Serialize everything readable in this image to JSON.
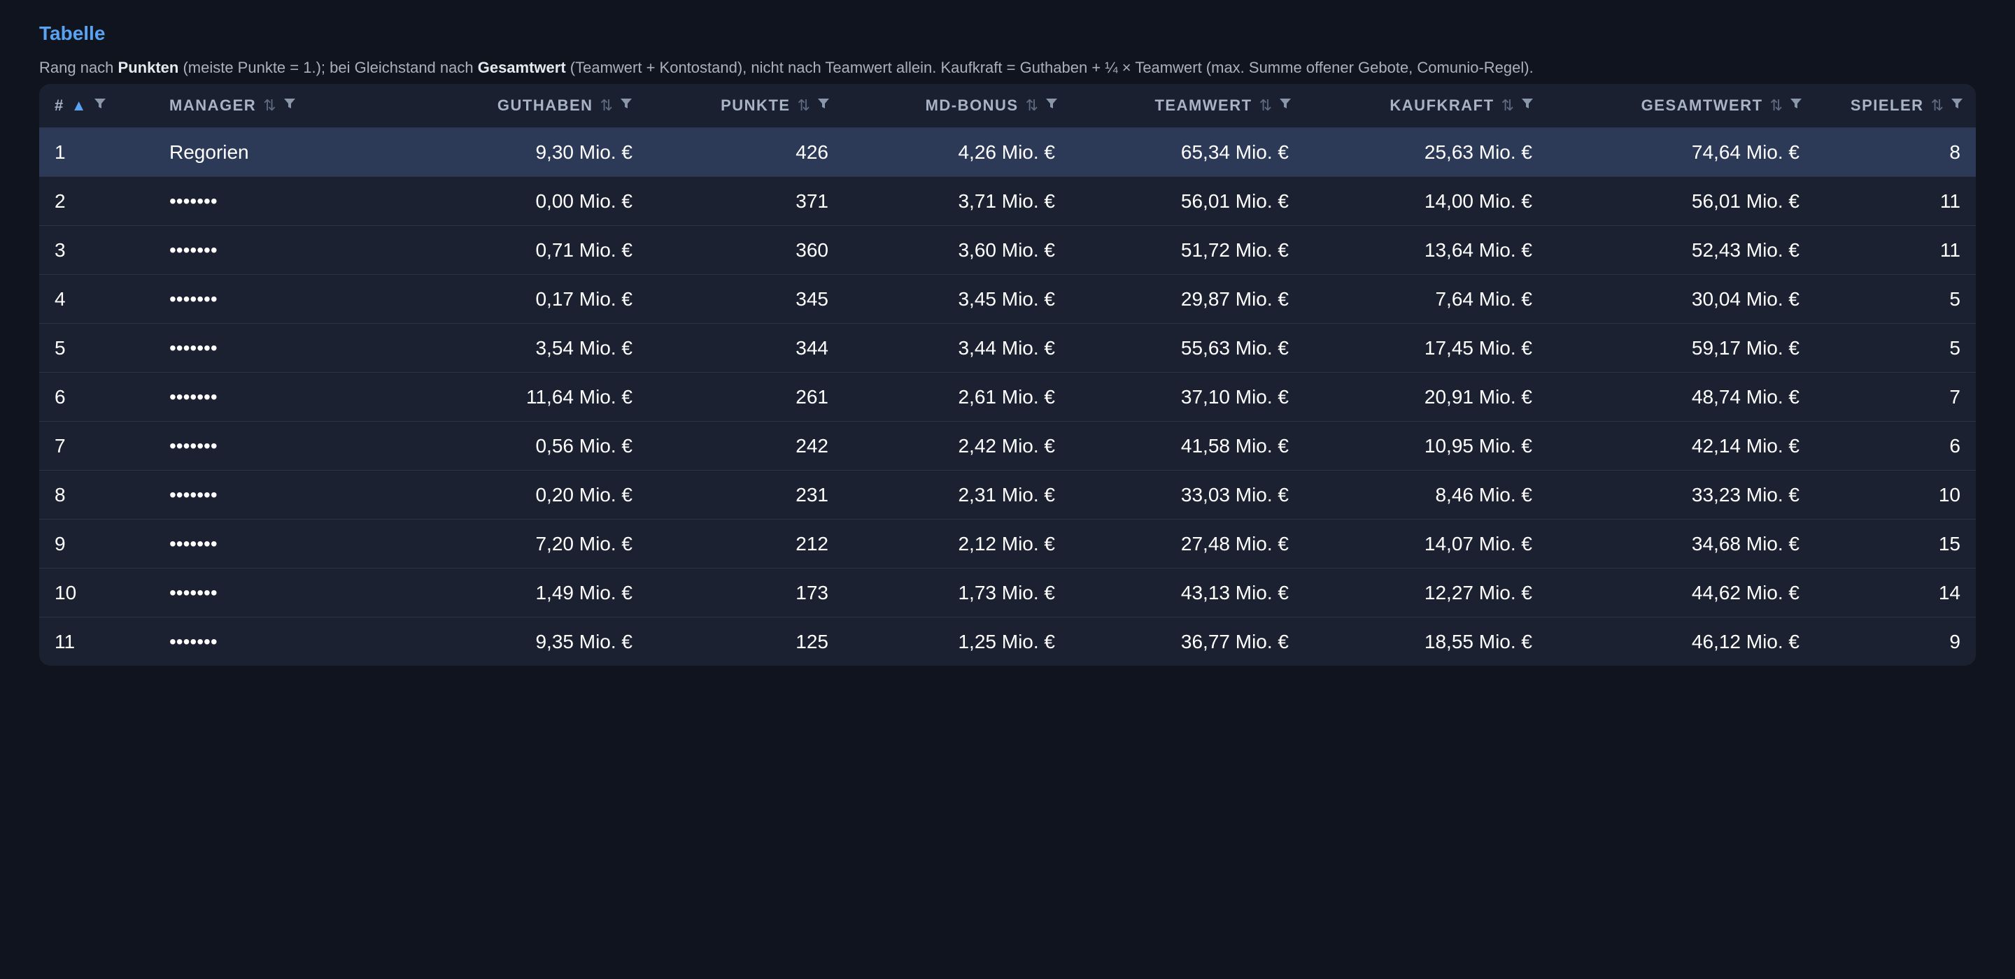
{
  "page": {
    "title": "Tabelle",
    "description": {
      "p1": "Rang nach ",
      "b1": "Punkten",
      "p2": " (meiste Punkte = 1.); bei Gleichstand nach ",
      "b2": "Gesamtwert",
      "p3": " (Teamwert + Kontostand), nicht nach Teamwert allein. Kaufkraft = Guthaben + ¼ × Teamwert (max. Summe offener Gebote, Comunio-Regel)."
    }
  },
  "colors": {
    "background": "#10141e",
    "table_bg": "#1b2130",
    "highlight_row": "#2c3a58",
    "accent": "#5aa2f2",
    "header_text": "#a8b3c6"
  },
  "table": {
    "columns": [
      {
        "key": "rank",
        "label": "#",
        "sort": "ascending",
        "sort_icon": "sort-ascending-icon"
      },
      {
        "key": "manager",
        "label": "MANAGER",
        "sort": "none",
        "sort_icon": "sort-both-icon"
      },
      {
        "key": "guthaben",
        "label": "GUTHABEN",
        "sort": "none",
        "sort_icon": "sort-both-icon"
      },
      {
        "key": "punkte",
        "label": "PUNKTE",
        "sort": "none",
        "sort_icon": "sort-both-icon"
      },
      {
        "key": "md_bonus",
        "label": "MD-BONUS",
        "sort": "none",
        "sort_icon": "sort-both-icon"
      },
      {
        "key": "teamwert",
        "label": "TEAMWERT",
        "sort": "none",
        "sort_icon": "sort-both-icon"
      },
      {
        "key": "kaufkraft",
        "label": "KAUFKRAFT",
        "sort": "none",
        "sort_icon": "sort-both-icon"
      },
      {
        "key": "gesamtwert",
        "label": "GESAMTWERT",
        "sort": "none",
        "sort_icon": "sort-both-icon"
      },
      {
        "key": "spieler",
        "label": "SPIELER",
        "sort": "none",
        "sort_icon": "sort-both-icon"
      }
    ],
    "sort_glyphs": {
      "ascending": "▲",
      "both": "⇅"
    },
    "rows": [
      {
        "rank": "1",
        "manager": "Regorien",
        "guthaben": "9,30 Mio. €",
        "punkte": "426",
        "md_bonus": "4,26 Mio. €",
        "teamwert": "65,34 Mio. €",
        "kaufkraft": "25,63 Mio. €",
        "gesamtwert": "74,64 Mio. €",
        "spieler": "8",
        "highlighted": true
      },
      {
        "rank": "2",
        "manager": "•••••••",
        "guthaben": "0,00 Mio. €",
        "punkte": "371",
        "md_bonus": "3,71 Mio. €",
        "teamwert": "56,01 Mio. €",
        "kaufkraft": "14,00 Mio. €",
        "gesamtwert": "56,01 Mio. €",
        "spieler": "11",
        "highlighted": false
      },
      {
        "rank": "3",
        "manager": "•••••••",
        "guthaben": "0,71 Mio. €",
        "punkte": "360",
        "md_bonus": "3,60 Mio. €",
        "teamwert": "51,72 Mio. €",
        "kaufkraft": "13,64 Mio. €",
        "gesamtwert": "52,43 Mio. €",
        "spieler": "11",
        "highlighted": false
      },
      {
        "rank": "4",
        "manager": "•••••••",
        "guthaben": "0,17 Mio. €",
        "punkte": "345",
        "md_bonus": "3,45 Mio. €",
        "teamwert": "29,87 Mio. €",
        "kaufkraft": "7,64 Mio. €",
        "gesamtwert": "30,04 Mio. €",
        "spieler": "5",
        "highlighted": false
      },
      {
        "rank": "5",
        "manager": "•••••••",
        "guthaben": "3,54 Mio. €",
        "punkte": "344",
        "md_bonus": "3,44 Mio. €",
        "teamwert": "55,63 Mio. €",
        "kaufkraft": "17,45 Mio. €",
        "gesamtwert": "59,17 Mio. €",
        "spieler": "5",
        "highlighted": false
      },
      {
        "rank": "6",
        "manager": "•••••••",
        "guthaben": "11,64 Mio. €",
        "punkte": "261",
        "md_bonus": "2,61 Mio. €",
        "teamwert": "37,10 Mio. €",
        "kaufkraft": "20,91 Mio. €",
        "gesamtwert": "48,74 Mio. €",
        "spieler": "7",
        "highlighted": false
      },
      {
        "rank": "7",
        "manager": "•••••••",
        "guthaben": "0,56 Mio. €",
        "punkte": "242",
        "md_bonus": "2,42 Mio. €",
        "teamwert": "41,58 Mio. €",
        "kaufkraft": "10,95 Mio. €",
        "gesamtwert": "42,14 Mio. €",
        "spieler": "6",
        "highlighted": false
      },
      {
        "rank": "8",
        "manager": "•••••••",
        "guthaben": "0,20 Mio. €",
        "punkte": "231",
        "md_bonus": "2,31 Mio. €",
        "teamwert": "33,03 Mio. €",
        "kaufkraft": "8,46 Mio. €",
        "gesamtwert": "33,23 Mio. €",
        "spieler": "10",
        "highlighted": false
      },
      {
        "rank": "9",
        "manager": "•••••••",
        "guthaben": "7,20 Mio. €",
        "punkte": "212",
        "md_bonus": "2,12 Mio. €",
        "teamwert": "27,48 Mio. €",
        "kaufkraft": "14,07 Mio. €",
        "gesamtwert": "34,68 Mio. €",
        "spieler": "15",
        "highlighted": false
      },
      {
        "rank": "10",
        "manager": "•••••••",
        "guthaben": "1,49 Mio. €",
        "punkte": "173",
        "md_bonus": "1,73 Mio. €",
        "teamwert": "43,13 Mio. €",
        "kaufkraft": "12,27 Mio. €",
        "gesamtwert": "44,62 Mio. €",
        "spieler": "14",
        "highlighted": false
      },
      {
        "rank": "11",
        "manager": "•••••••",
        "guthaben": "9,35 Mio. €",
        "punkte": "125",
        "md_bonus": "1,25 Mio. €",
        "teamwert": "36,77 Mio. €",
        "kaufkraft": "18,55 Mio. €",
        "gesamtwert": "46,12 Mio. €",
        "spieler": "9",
        "highlighted": false
      }
    ]
  }
}
